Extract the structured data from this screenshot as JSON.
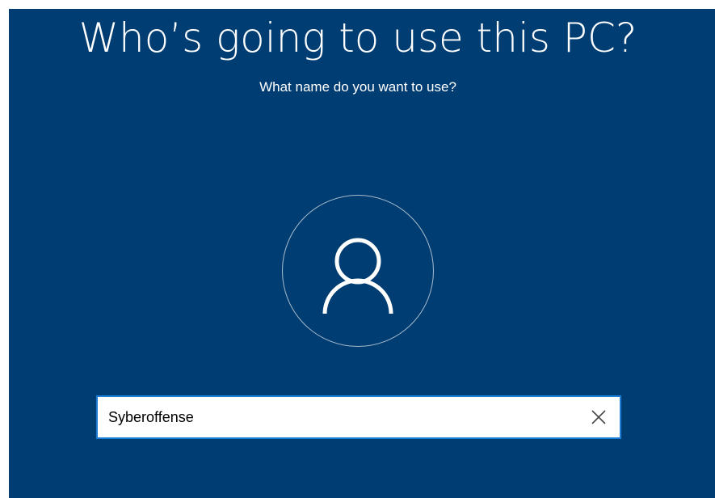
{
  "setup": {
    "title": "Who’s going to use this PC?",
    "subtitle": "What name do you want to use?"
  },
  "avatar": {
    "icon": "user-icon"
  },
  "name_field": {
    "value": "Syberoffense",
    "clear_icon": "close-icon"
  },
  "colors": {
    "background": "#003d72",
    "text": "#ffffff",
    "input_border": "#1a7fd4",
    "avatar_ring": "#a9bccd"
  }
}
